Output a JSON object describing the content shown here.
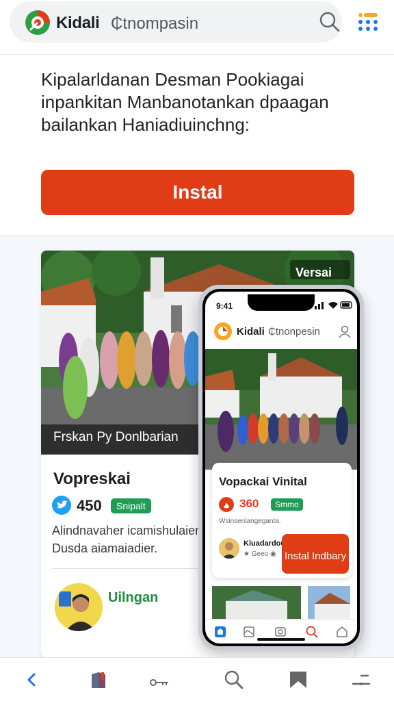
{
  "header": {
    "brand": "Kidali",
    "brand_sub": "₵tnompasin",
    "logo_icon": "kidali-logo",
    "search_icon": "search-icon",
    "grid_icon": "apps-grid-icon",
    "accent_color": "#e03d17"
  },
  "intro": {
    "text": "Kipalarldanan Desman Pookiagai inpankitan Manbanotankan dpaagan bailankan Haniadiuinchng:",
    "install_label": "Instal"
  },
  "card": {
    "photo_caption": "Frskan Py Donlbarian",
    "badge_top": "Versai",
    "title": "Vopreskai",
    "rating": "450",
    "status_badge": "Snipalt",
    "description": "Alindnavaher icamishulaiena Dusda aiamaiadier.",
    "author": "Uilngan",
    "status_color": "#1f9d55"
  },
  "phone": {
    "time": "9:41",
    "brand": "Kidali",
    "brand_sub": "₵tnonpesin",
    "title": "Vopackai Vinital",
    "rating": "360",
    "status_badge": "Smmo",
    "description": "Wsinsenlangeganta.",
    "author_name": "Kiuadardou",
    "author_meta": "★ Geeo ◉",
    "install_label": "Instal Indbary"
  },
  "bottom_nav": {
    "items": [
      "back-icon",
      "library-icon",
      "key-icon",
      "search-icon",
      "bookmark-icon",
      "more-icon"
    ]
  }
}
